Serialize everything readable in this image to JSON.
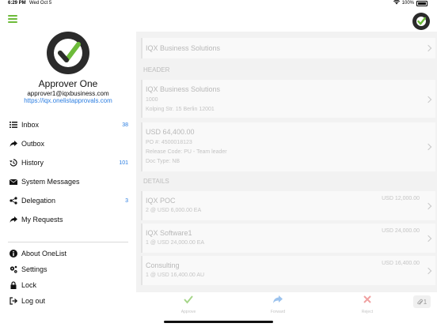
{
  "status_bar": {
    "time": "6:29 PM",
    "date": "Wed Oct 5",
    "battery": "100%"
  },
  "profile": {
    "name": "Approver One",
    "email": "approver1@iqxbusiness.com",
    "url": "https://iqx.onelistapprovals.com"
  },
  "menu": [
    {
      "label": "Inbox",
      "icon": "list-icon",
      "count": "38"
    },
    {
      "label": "Outbox",
      "icon": "forward-arrow-icon",
      "count": ""
    },
    {
      "label": "History",
      "icon": "history-icon",
      "count": "101"
    },
    {
      "label": "System Messages",
      "icon": "envelope-icon",
      "count": ""
    },
    {
      "label": "Delegation",
      "icon": "share-icon",
      "count": "3"
    },
    {
      "label": "My Requests",
      "icon": "forward-arrow-icon",
      "count": ""
    }
  ],
  "secondary_menu": [
    {
      "label": "About OneList",
      "icon": "info-icon"
    },
    {
      "label": "Settings",
      "icon": "gears-icon"
    },
    {
      "label": "Lock",
      "icon": "lock-icon"
    },
    {
      "label": "Log out",
      "icon": "logout-icon"
    }
  ],
  "detail": {
    "top_item": "IQX Business Solutions",
    "header_label": "HEADER",
    "header_card": {
      "title": "IQX Business Solutions",
      "line1": "1000",
      "line2": "Kolping Str. 15 Berlin 12001"
    },
    "amount_card": {
      "title": "USD 64,400.00",
      "line1": "PO #: 4500018123",
      "line2": "Release Code: PU - Team leader",
      "line3": "Doc Type: NB"
    },
    "details_label": "DETAILS",
    "items": [
      {
        "title": "IQX POC",
        "sub": "2 @ USD 6,000.00 EA",
        "amount": "USD 12,000.00"
      },
      {
        "title": "IQX Software1",
        "sub": "1 @ USD 24,000.00 EA",
        "amount": "USD 24,000.00"
      },
      {
        "title": "Consulting",
        "sub": "1 @ USD 16,400.00 AU",
        "amount": "USD 16,400.00"
      }
    ]
  },
  "toolbar": {
    "approve": "Approve",
    "forward": "Forward",
    "reject": "Reject",
    "attachments": "1"
  },
  "colors": {
    "accent_green": "#6dbb3a",
    "link_blue": "#2a7de1",
    "reject_red": "#e05050"
  }
}
